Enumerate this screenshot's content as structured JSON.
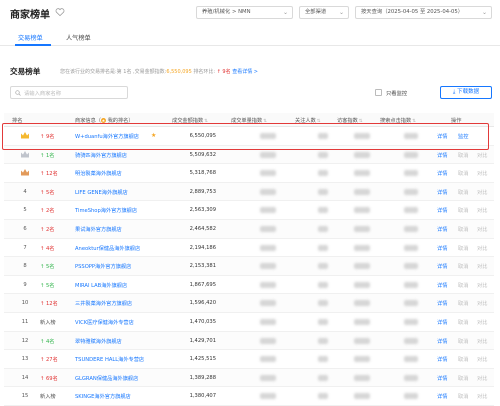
{
  "header": {
    "title": "商家榜单",
    "category_filter": "养殖/机械化 > NMN",
    "channel_filter": "全部渠道",
    "date_filter": "按天查询（2025-04-05 至 2025-04-05）"
  },
  "tabs": [
    {
      "label": "交易榜单",
      "active": true
    },
    {
      "label": "人气榜单",
      "active": false
    }
  ],
  "section": {
    "title": "交易榜单",
    "desc_prefix": "您在该行业的交易排名是:第 1名 ,交易金额指数:",
    "desc_index": "6,550,095",
    "desc_mid": " 排名环比: ",
    "desc_change": "↑ 9名",
    "desc_link": "查看详情 >"
  },
  "search": {
    "placeholder": "请输入商家名称"
  },
  "toolbar": {
    "monitor_only_label": "只看监控",
    "download_label": "下载数据"
  },
  "table": {
    "headers": {
      "rank": "排名",
      "shop": "商家信息（",
      "shop_suffix": " 我的排名）",
      "sales": "成交金额指数",
      "orders": "成交单量指数",
      "followers": "关注人数",
      "visits": "访客指数",
      "search": "搜索点击指数",
      "ops": "操作"
    },
    "action_detail": "详情",
    "action_monitor": "监控",
    "action_cancel": "取消",
    "action_compare": "对比",
    "rows": [
      {
        "rank": "",
        "change": "↑ 9名",
        "dir": "up",
        "shop": "W+duanfu海外官方旗舰店",
        "sales": "6,550,095",
        "mine": true,
        "crown": "gold"
      },
      {
        "rank": "",
        "change": "↑ 1名",
        "dir": "down",
        "shop": "骑骑匹海外官方旗舰店",
        "sales": "5,509,632",
        "crown": "silver"
      },
      {
        "rank": "",
        "change": "↑ 12名",
        "dir": "up",
        "shop": "明治製薬海外旗舰店",
        "sales": "5,318,768",
        "crown": "bronze"
      },
      {
        "rank": "4",
        "change": "↑ 5名",
        "dir": "up",
        "shop": "LIFE GENE海外旗舰店",
        "sales": "2,889,753"
      },
      {
        "rank": "5",
        "change": "↑ 2名",
        "dir": "up",
        "shop": "TimeShop海外官方旗舰店",
        "sales": "2,563,309"
      },
      {
        "rank": "6",
        "change": "↑ 2名",
        "dir": "up",
        "shop": "果试海外官方旗舰店",
        "sales": "2,464,582"
      },
      {
        "rank": "7",
        "change": "↑ 4名",
        "dir": "up",
        "shop": "Aneoktur保健品海外旗舰店",
        "sales": "2,194,186"
      },
      {
        "rank": "8",
        "change": "↑ 5名",
        "dir": "down",
        "shop": "PSSOPP海外官方旗舰店",
        "sales": "2,153,381"
      },
      {
        "rank": "9",
        "change": "↑ 5名",
        "dir": "down",
        "shop": "MIRAI LAB海外旗舰店",
        "sales": "1,867,695"
      },
      {
        "rank": "10",
        "change": "↑ 12名",
        "dir": "up",
        "shop": "三井製薬海外官方旗舰店",
        "sales": "1,596,420"
      },
      {
        "rank": "11",
        "change": "新入榜",
        "dir": "new",
        "shop": "VICK医疗保健海外专营店",
        "sales": "1,470,035"
      },
      {
        "rank": "12",
        "change": "↑ 4名",
        "dir": "down",
        "shop": "翠特雅赋海外旗舰店",
        "sales": "1,429,701"
      },
      {
        "rank": "13",
        "change": "↑ 27名",
        "dir": "up",
        "shop": "TSUNDERE HALL海外专营店",
        "sales": "1,425,515"
      },
      {
        "rank": "14",
        "change": "↑ 69名",
        "dir": "up",
        "shop": "GLGRAN保健品海外旗舰店",
        "sales": "1,389,288"
      },
      {
        "rank": "15",
        "change": "新入榜",
        "dir": "new",
        "shop": "SKINGE海外官方旗舰店",
        "sales": "1,380,407"
      }
    ]
  },
  "colors": {
    "accent": "#1677ff",
    "up": "#e03030",
    "down": "#2fb34a",
    "highlight": "#e23a3a"
  }
}
